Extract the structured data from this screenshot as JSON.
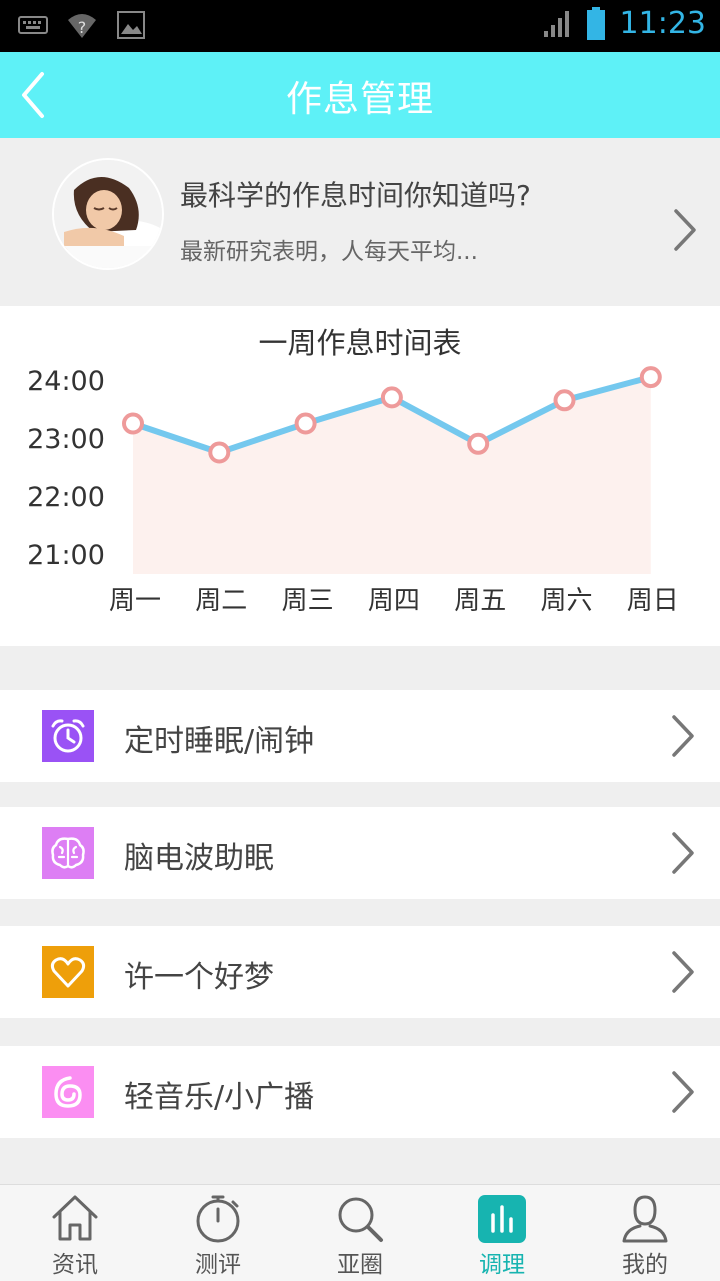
{
  "status_bar": {
    "time": "11:23"
  },
  "app_bar": {
    "title": "作息管理"
  },
  "article": {
    "headline": "最科学的作息时间你知道吗?",
    "summary": "最新研究表明，人每天平均..."
  },
  "chart_data": {
    "type": "line",
    "title": "一周作息时间表",
    "categories": [
      "周一",
      "周二",
      "周三",
      "周四",
      "周五",
      "周六",
      "周日"
    ],
    "series": [
      {
        "values": [
          23.25,
          22.75,
          23.25,
          23.7,
          22.9,
          23.65,
          24.05
        ]
      }
    ],
    "y_ticks": [
      "24:00",
      "23:00",
      "22:00",
      "21:00"
    ],
    "ylim": [
      21,
      24
    ],
    "colors": {
      "line": "#74c8ee",
      "marker": "#ee9a9a",
      "fill": "#fdf1ee"
    }
  },
  "menu": [
    {
      "label": "定时睡眠/闹钟",
      "icon": "alarm-clock-icon",
      "color": "#9a52f5"
    },
    {
      "label": "脑电波助眠",
      "icon": "brain-icon",
      "color": "#dd7ef4"
    },
    {
      "label": "许一个好梦",
      "icon": "heart-icon",
      "color": "#ee9f0a"
    },
    {
      "label": "轻音乐/小广播",
      "icon": "music-swirl-icon",
      "color": "#fb8ef2"
    }
  ],
  "tabs": [
    {
      "label": "资讯",
      "icon": "home-icon"
    },
    {
      "label": "测评",
      "icon": "stopwatch-icon"
    },
    {
      "label": "亚圈",
      "icon": "search-icon"
    },
    {
      "label": "调理",
      "icon": "bar-chart-icon",
      "active": true
    },
    {
      "label": "我的",
      "icon": "user-icon"
    }
  ],
  "accent_color": "#17b4b0"
}
